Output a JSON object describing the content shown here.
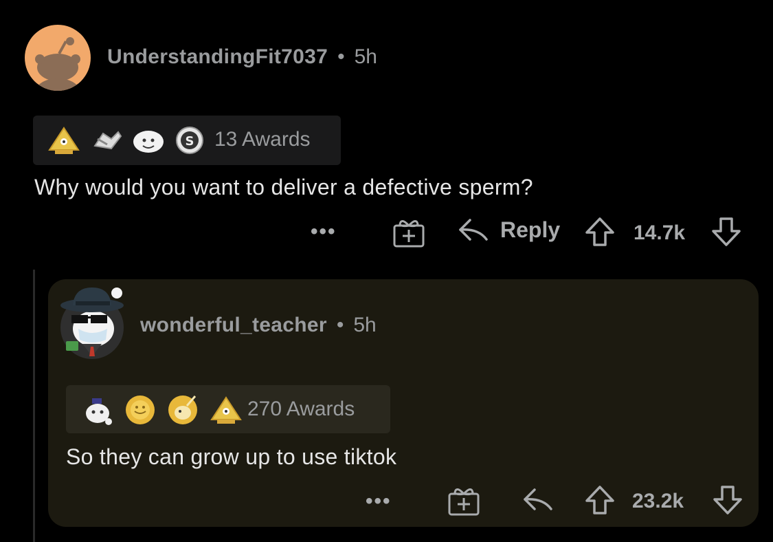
{
  "comment": {
    "username": "UnderstandingFit7037",
    "separator": "•",
    "time": "5h",
    "awards_label": "13 Awards",
    "body": "Why would you want to deliver a defective sperm?",
    "more_label": "•••",
    "reply_label": "Reply",
    "score": "14.7k",
    "avatar_color": "#f2a96b"
  },
  "reply": {
    "username": "wonderful_teacher",
    "separator": "•",
    "time": "5h",
    "awards_label": "270 Awards",
    "body": "So they can grow up to use tiktok",
    "more_label": "•••",
    "score": "23.2k",
    "card_color": "#1c1a10"
  },
  "icons": [
    "snoo-avatar",
    "award-icon",
    "gift-icon",
    "reply-arrow-icon",
    "upvote-icon",
    "downvote-icon"
  ]
}
